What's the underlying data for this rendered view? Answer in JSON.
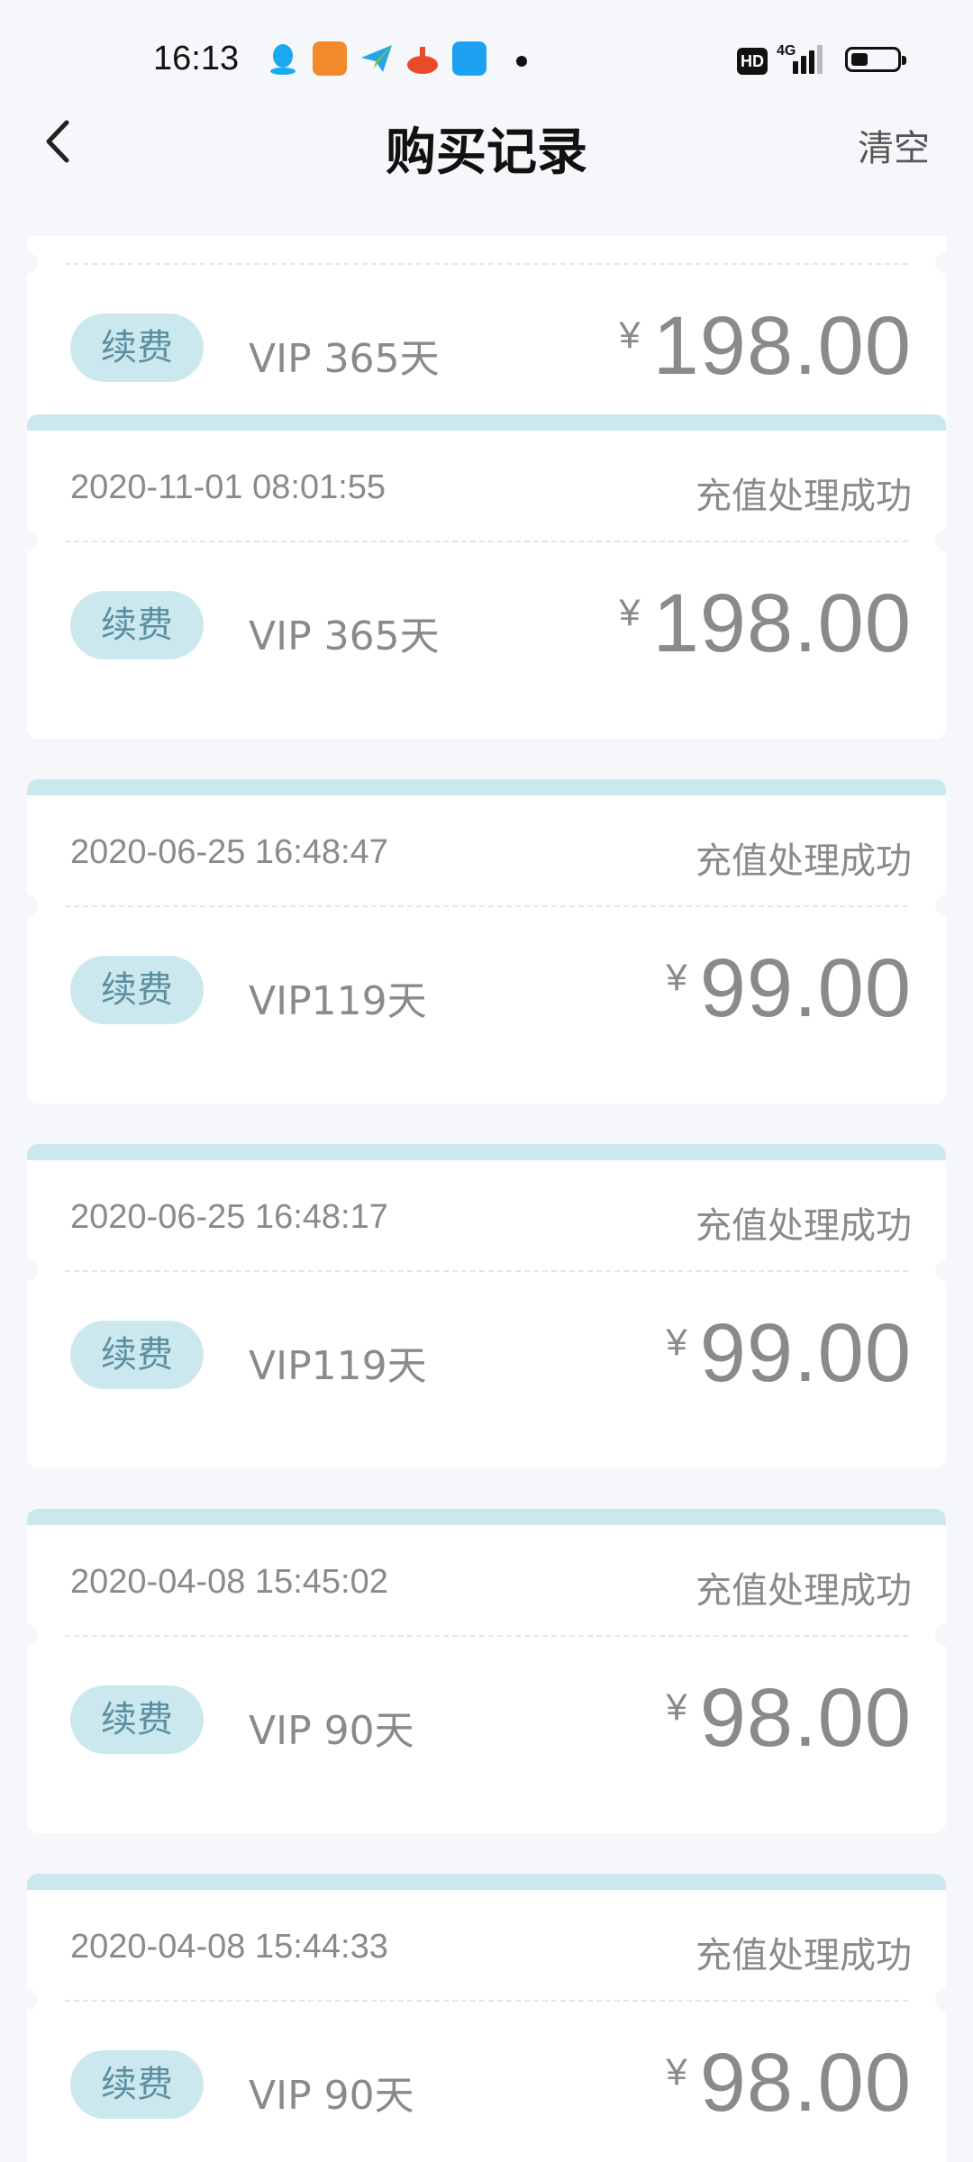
{
  "status_bar": {
    "time": "16:13",
    "network": "4G",
    "hd": "HD"
  },
  "header": {
    "title": "购买记录",
    "clear_label": "清空"
  },
  "records": [
    {
      "date": "",
      "status": "",
      "tag": "续费",
      "product": "VIP 365天",
      "currency": "¥",
      "amount": "198.00"
    },
    {
      "date": "2020-11-01 08:01:55",
      "status": "充值处理成功",
      "tag": "续费",
      "product": "VIP 365天",
      "currency": "¥",
      "amount": "198.00"
    },
    {
      "date": "2020-06-25 16:48:47",
      "status": "充值处理成功",
      "tag": "续费",
      "product": "VIP119天",
      "currency": "¥",
      "amount": "99.00"
    },
    {
      "date": "2020-06-25 16:48:17",
      "status": "充值处理成功",
      "tag": "续费",
      "product": "VIP119天",
      "currency": "¥",
      "amount": "99.00"
    },
    {
      "date": "2020-04-08 15:45:02",
      "status": "充值处理成功",
      "tag": "续费",
      "product": "VIP 90天",
      "currency": "¥",
      "amount": "98.00"
    },
    {
      "date": "2020-04-08 15:44:33",
      "status": "充值处理成功",
      "tag": "续费",
      "product": "VIP 90天",
      "currency": "¥",
      "amount": "98.00"
    }
  ],
  "colors": {
    "background": "#F5F7FA",
    "accent_light": "#CCE8EF",
    "text_gray": "#8A8A8A"
  }
}
